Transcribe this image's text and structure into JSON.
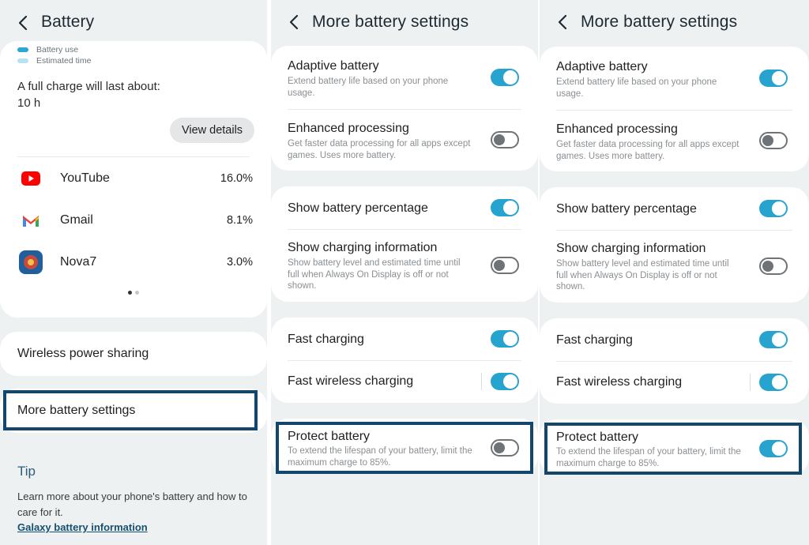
{
  "panel1": {
    "title": "Battery",
    "legend": [
      {
        "label": "Battery use",
        "color": "#2aa8d4"
      },
      {
        "label": "Estimated time",
        "color": "#b9e2f1"
      }
    ],
    "charge_label": "A full charge will last about:",
    "charge_value": "10 h",
    "view_details": "View details",
    "apps": [
      {
        "name": "YouTube",
        "percent": "16.0%",
        "icon": "youtube-icon"
      },
      {
        "name": "Gmail",
        "percent": "8.1%",
        "icon": "gmail-icon"
      },
      {
        "name": "Nova7",
        "percent": "3.0%",
        "icon": "nova7-icon"
      }
    ],
    "wireless_power_sharing": "Wireless power sharing",
    "more_battery_settings": "More battery settings",
    "tip_title": "Tip",
    "tip_text": "Learn more about your phone's battery and how to care for it.",
    "tip_link": "Galaxy battery information"
  },
  "panel2": {
    "title": "More battery settings",
    "adaptive": {
      "title": "Adaptive battery",
      "desc": "Extend battery life based on your phone usage.",
      "on": true
    },
    "enhanced": {
      "title": "Enhanced processing",
      "desc": "Get faster data processing for all apps except games. Uses more battery.",
      "on": false
    },
    "show_pct": {
      "title": "Show battery percentage",
      "on": true
    },
    "charging_info": {
      "title": "Show charging information",
      "desc": "Show battery level and estimated time until full when Always On Display is off or not shown.",
      "on": false
    },
    "fast": {
      "title": "Fast charging",
      "on": true
    },
    "fast_wireless": {
      "title": "Fast wireless charging",
      "on": true
    },
    "protect": {
      "title": "Protect battery",
      "desc": "To extend the lifespan of your battery, limit the maximum charge to 85%.",
      "on": false
    }
  },
  "panel3": {
    "title": "More battery settings",
    "adaptive": {
      "title": "Adaptive battery",
      "desc": "Extend battery life based on your phone usage.",
      "on": true
    },
    "enhanced": {
      "title": "Enhanced processing",
      "desc": "Get faster data processing for all apps except games. Uses more battery.",
      "on": false
    },
    "show_pct": {
      "title": "Show battery percentage",
      "on": true
    },
    "charging_info": {
      "title": "Show charging information",
      "desc": "Show battery level and estimated time until full when Always On Display is off or not shown.",
      "on": false
    },
    "fast": {
      "title": "Fast charging",
      "on": true
    },
    "fast_wireless": {
      "title": "Fast wireless charging",
      "on": true
    },
    "protect": {
      "title": "Protect battery",
      "desc": "To extend the lifespan of your battery, limit the maximum charge to 85%.",
      "on": true
    }
  },
  "colors": {
    "accent": "#27a3d0",
    "highlight": "#12466d",
    "background": "#eef1f2"
  }
}
